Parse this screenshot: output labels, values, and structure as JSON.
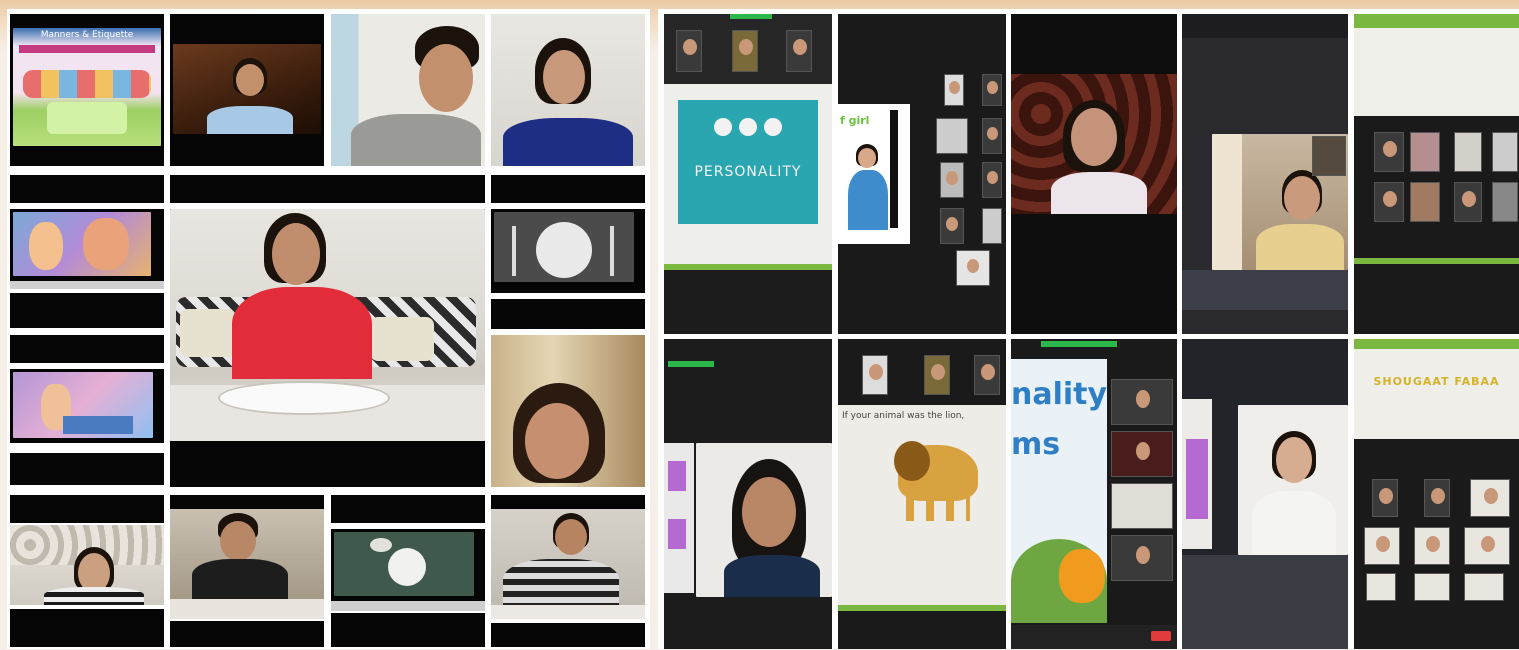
{
  "left_collage": {
    "slide1": {
      "title": "Manners & Etiquette"
    }
  },
  "right_collage": {
    "personality_slide": {
      "title": "PERSONALITY"
    },
    "girl_label": "f girl",
    "lion_caption": "If your animal was the lion,",
    "naility_big": "nality",
    "ms_big": "ms",
    "banner": "SHOUGAAT FABAA"
  },
  "colors": {
    "teal": "#2aa6b0",
    "zoom_green": "#2bb74a",
    "banner_green": "#7ab842",
    "red_shirt": "#e22c3a"
  }
}
